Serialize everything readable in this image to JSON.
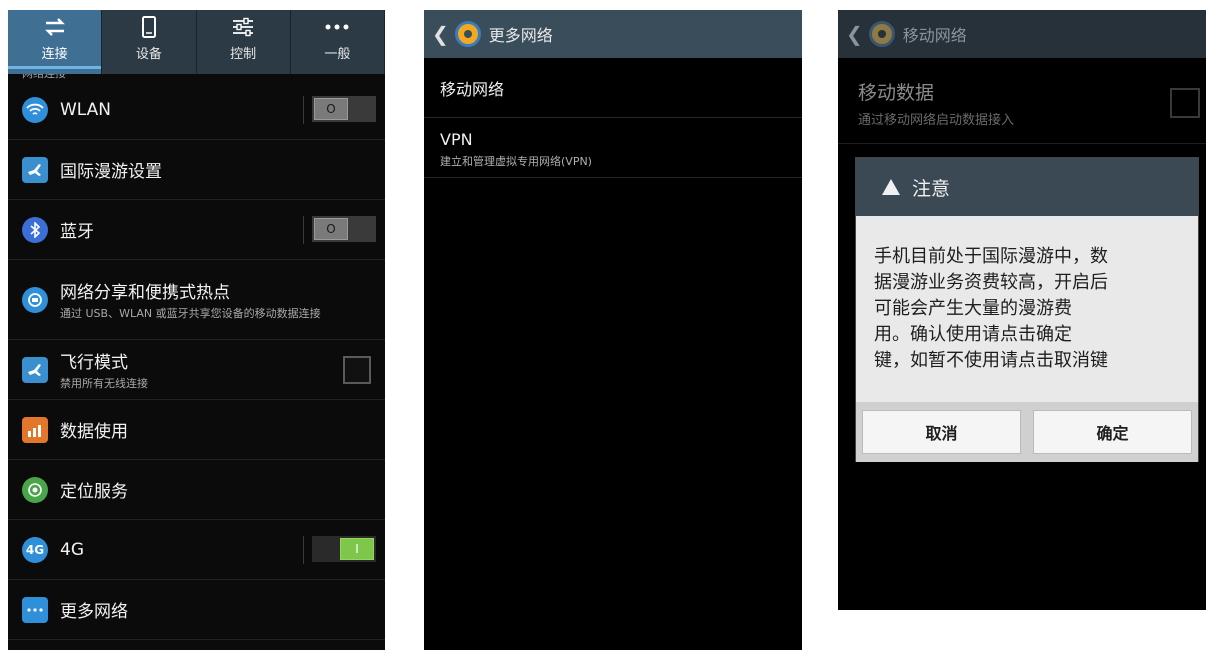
{
  "screen1": {
    "tabs": [
      {
        "label": "连接",
        "icon": "swap-arrows-icon",
        "active": true
      },
      {
        "label": "设备",
        "icon": "phone-icon",
        "active": false
      },
      {
        "label": "控制",
        "icon": "sliders-icon",
        "active": false
      },
      {
        "label": "一般",
        "icon": "more-dots-icon",
        "active": false
      }
    ],
    "section_peek": "网络连接",
    "rows": [
      {
        "title": "WLAN",
        "toggle": "off",
        "toggle_glyph": "O"
      },
      {
        "title": "国际漫游设置"
      },
      {
        "title": "蓝牙",
        "toggle": "off",
        "toggle_glyph": "O"
      },
      {
        "title": "网络分享和便携式热点",
        "subtitle": "通过 USB、WLAN 或蓝牙共享您设备的移动数据连接"
      },
      {
        "title": "飞行模式",
        "subtitle": "禁用所有无线连接",
        "checkbox": "unchecked"
      },
      {
        "title": "数据使用"
      },
      {
        "title": "定位服务"
      },
      {
        "title": "4G",
        "icon_text": "4G",
        "toggle": "on",
        "toggle_glyph": "I"
      },
      {
        "title": "更多网络"
      }
    ],
    "colors": {
      "accent_tab": "#3f6f93",
      "toggle_on": "#7fc74a"
    }
  },
  "screen2": {
    "title": "更多网络",
    "items": [
      {
        "title": "移动网络"
      },
      {
        "title": "VPN",
        "subtitle": "建立和管理虚拟专用网络(VPN)"
      }
    ]
  },
  "screen3": {
    "title": "移动网络",
    "row": {
      "title": "移动数据",
      "subtitle": "通过移动网络启动数据接入"
    },
    "dialog": {
      "title": "注意",
      "lines": [
        "手机目前处于国际漫游中，数",
        "据漫游业务资费较高，开启后",
        "可能会产生大量的漫游费",
        "用。确认使用请点击确定",
        "键，如暂不使用请点击取消键"
      ],
      "cancel": "取消",
      "ok": "确定"
    }
  }
}
